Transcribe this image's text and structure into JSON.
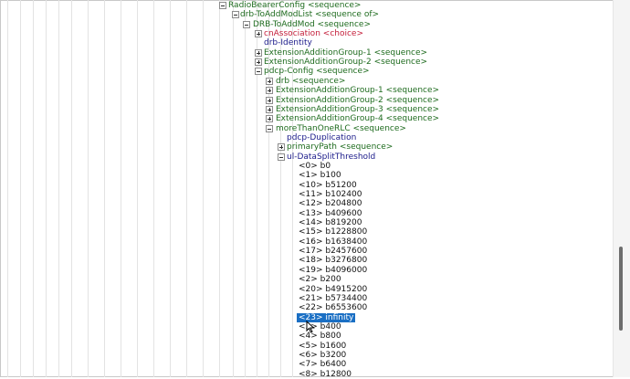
{
  "tree_rows": [
    {
      "text": "RadioBearerConfig",
      "kind": "<sequence>",
      "kind_color": "seq",
      "expander": "minus"
    },
    {
      "text": "drb-ToAddModList",
      "kind": "<sequence of>",
      "kind_color": "seq",
      "expander": "minus"
    },
    {
      "text": "DRB-ToAddMod",
      "kind": "<sequence>",
      "kind_color": "seq",
      "expander": "minus"
    },
    {
      "text": "cnAssociation",
      "kind": "<choice>",
      "kind_color": "choice",
      "expander": "plus"
    },
    {
      "text": "drb-Identity",
      "kind": "",
      "kind_color": "navy",
      "expander": "none"
    },
    {
      "text": "ExtensionAdditionGroup-1",
      "kind": "<sequence>",
      "kind_color": "seq",
      "expander": "plus"
    },
    {
      "text": "ExtensionAdditionGroup-2",
      "kind": "<sequence>",
      "kind_color": "seq",
      "expander": "plus"
    },
    {
      "text": "pdcp-Config",
      "kind": "<sequence>",
      "kind_color": "seq",
      "expander": "minus"
    },
    {
      "text": "drb",
      "kind": "<sequence>",
      "kind_color": "seq",
      "expander": "plus"
    },
    {
      "text": "ExtensionAdditionGroup-1",
      "kind": "<sequence>",
      "kind_color": "seq",
      "expander": "plus"
    },
    {
      "text": "ExtensionAdditionGroup-2",
      "kind": "<sequence>",
      "kind_color": "seq",
      "expander": "plus"
    },
    {
      "text": "ExtensionAdditionGroup-3",
      "kind": "<sequence>",
      "kind_color": "seq",
      "expander": "plus"
    },
    {
      "text": "ExtensionAdditionGroup-4",
      "kind": "<sequence>",
      "kind_color": "seq",
      "expander": "plus"
    },
    {
      "text": "moreThanOneRLC",
      "kind": "<sequence>",
      "kind_color": "seq",
      "expander": "minus"
    },
    {
      "text": "pdcp-Duplication",
      "kind": "",
      "kind_color": "navy",
      "expander": "none"
    },
    {
      "text": "primaryPath",
      "kind": "<sequence>",
      "kind_color": "seq",
      "expander": "plus"
    },
    {
      "text": "ul-DataSplitThreshold",
      "kind": "",
      "kind_color": "navy",
      "expander": "minus"
    },
    {
      "text": "<0> b0",
      "kind": "",
      "kind_color": "val",
      "expander": "none"
    },
    {
      "text": "<1> b100",
      "kind": "",
      "kind_color": "val",
      "expander": "none"
    },
    {
      "text": "<10> b51200",
      "kind": "",
      "kind_color": "val",
      "expander": "none"
    },
    {
      "text": "<11> b102400",
      "kind": "",
      "kind_color": "val",
      "expander": "none"
    },
    {
      "text": "<12> b204800",
      "kind": "",
      "kind_color": "val",
      "expander": "none"
    },
    {
      "text": "<13> b409600",
      "kind": "",
      "kind_color": "val",
      "expander": "none"
    },
    {
      "text": "<14> b819200",
      "kind": "",
      "kind_color": "val",
      "expander": "none"
    },
    {
      "text": "<15> b1228800",
      "kind": "",
      "kind_color": "val",
      "expander": "none"
    },
    {
      "text": "<16> b1638400",
      "kind": "",
      "kind_color": "val",
      "expander": "none"
    },
    {
      "text": "<17> b2457600",
      "kind": "",
      "kind_color": "val",
      "expander": "none"
    },
    {
      "text": "<18> b3276800",
      "kind": "",
      "kind_color": "val",
      "expander": "none"
    },
    {
      "text": "<19> b4096000",
      "kind": "",
      "kind_color": "val",
      "expander": "none"
    },
    {
      "text": "<2> b200",
      "kind": "",
      "kind_color": "val",
      "expander": "none"
    },
    {
      "text": "<20> b4915200",
      "kind": "",
      "kind_color": "val",
      "expander": "none"
    },
    {
      "text": "<21> b5734400",
      "kind": "",
      "kind_color": "val",
      "expander": "none"
    },
    {
      "text": "<22> b6553600",
      "kind": "",
      "kind_color": "val",
      "expander": "none"
    },
    {
      "text": "<23> infinity",
      "kind": "",
      "kind_color": "val",
      "expander": "none",
      "selected": true
    },
    {
      "text": "<3> b400",
      "kind": "",
      "kind_color": "val",
      "expander": "none"
    },
    {
      "text": "<4> b800",
      "kind": "",
      "kind_color": "val",
      "expander": "none"
    },
    {
      "text": "<5> b1600",
      "kind": "",
      "kind_color": "val",
      "expander": "none"
    },
    {
      "text": "<6> b3200",
      "kind": "",
      "kind_color": "val",
      "expander": "none"
    },
    {
      "text": "<7> b6400",
      "kind": "",
      "kind_color": "val",
      "expander": "none"
    },
    {
      "text": "<8> b12800",
      "kind": "",
      "kind_color": "val",
      "expander": "none"
    }
  ],
  "colors": {
    "sequence_label": "#1e6b1e",
    "choice_label": "#c41e3a",
    "field_label": "#1b1b8a",
    "selection_background": "#1a6fc4",
    "selection_text": "#ffffff",
    "guide_lines": "#e3e3e3"
  },
  "icons": {
    "expand": "plus-box-icon",
    "collapse": "minus-box-icon",
    "pointer": "mouse-pointer-icon"
  },
  "vertical_scrollbar": {
    "thumb_fraction_start": 0.65,
    "thumb_fraction_size": 0.22
  }
}
